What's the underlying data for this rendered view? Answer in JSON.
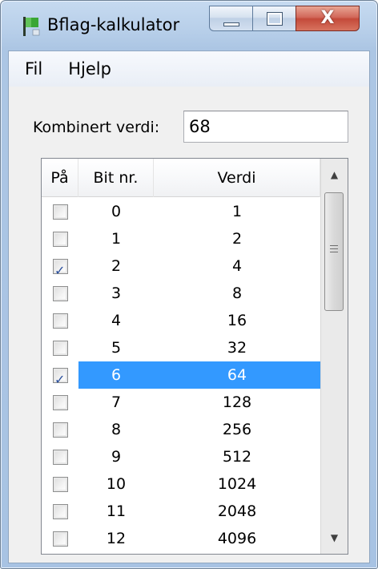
{
  "window": {
    "title": "Bflag-kalkulator",
    "close_symbol": "X",
    "icon": "flag-app-icon"
  },
  "menu": {
    "items": [
      "Fil",
      "Hjelp"
    ]
  },
  "combined": {
    "label": "Kombinert verdi:",
    "value": "68"
  },
  "grid": {
    "headers": {
      "on": "På",
      "bit": "Bit nr.",
      "value": "Verdi"
    },
    "selected_row": 6,
    "rows": [
      {
        "checked": false,
        "bit": "0",
        "value": "1"
      },
      {
        "checked": false,
        "bit": "1",
        "value": "2"
      },
      {
        "checked": true,
        "bit": "2",
        "value": "4"
      },
      {
        "checked": false,
        "bit": "3",
        "value": "8"
      },
      {
        "checked": false,
        "bit": "4",
        "value": "16"
      },
      {
        "checked": false,
        "bit": "5",
        "value": "32"
      },
      {
        "checked": true,
        "bit": "6",
        "value": "64"
      },
      {
        "checked": false,
        "bit": "7",
        "value": "128"
      },
      {
        "checked": false,
        "bit": "8",
        "value": "256"
      },
      {
        "checked": false,
        "bit": "9",
        "value": "512"
      },
      {
        "checked": false,
        "bit": "10",
        "value": "1024"
      },
      {
        "checked": false,
        "bit": "11",
        "value": "2048"
      },
      {
        "checked": false,
        "bit": "12",
        "value": "4096"
      }
    ]
  },
  "colors": {
    "selection": "#3399ff",
    "titlebar": "#b9d0ea",
    "close_button": "#c44a3a"
  }
}
